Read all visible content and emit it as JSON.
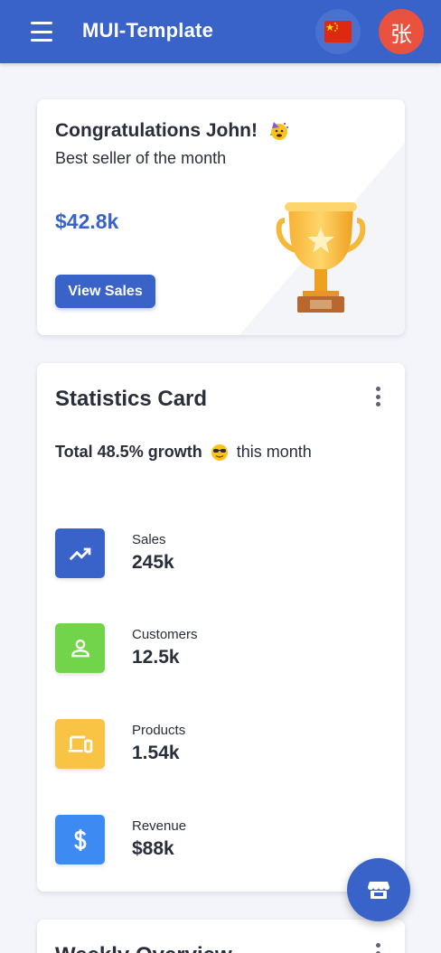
{
  "appbar": {
    "title": "MUI-Template",
    "menu_icon": "menu-icon",
    "language_icon": "china-flag-icon",
    "avatar_text": "张",
    "color": "#3a63c9"
  },
  "congrats_card": {
    "title": "Congratulations John!",
    "emoji": "party-face-icon",
    "subtitle": "Best seller of the month",
    "amount": "$42.8k",
    "button_label": "View Sales",
    "illustration": "trophy-icon"
  },
  "statistics_card": {
    "title": "Statistics Card",
    "growth_bold": "Total 48.5% growth",
    "growth_emoji": "sunglasses-face-icon",
    "growth_suffix": "this month",
    "stats": [
      {
        "label": "Sales",
        "value": "245k",
        "icon": "trending-up-icon",
        "color": "#3a63c9"
      },
      {
        "label": "Customers",
        "value": "12.5k",
        "icon": "person-icon",
        "color": "#71d44a"
      },
      {
        "label": "Products",
        "value": "1.54k",
        "icon": "devices-icon",
        "color": "#f9c443"
      },
      {
        "label": "Revenue",
        "value": "$88k",
        "icon": "dollar-icon",
        "color": "#3d8af2"
      }
    ]
  },
  "weekly_card": {
    "title": "Weekly Overview"
  },
  "fab": {
    "icon": "storefront-icon"
  }
}
